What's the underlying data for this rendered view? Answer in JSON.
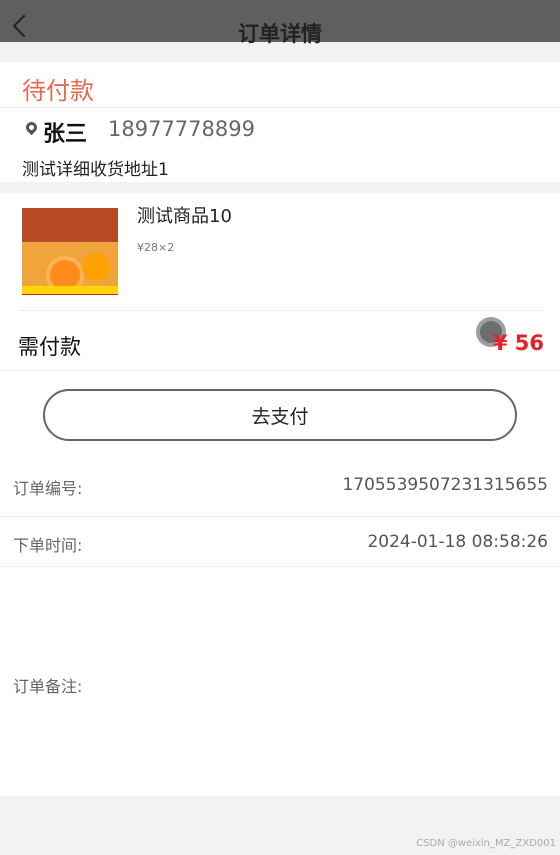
{
  "header": {
    "title": "订单详情",
    "back_icon": "chevron-left-icon"
  },
  "status": {
    "text": "待付款",
    "color": "#e46b4f"
  },
  "address": {
    "name": "张三",
    "phone": "18977778899",
    "detail": "测试详细收货地址1",
    "icon": "location-pin-icon"
  },
  "goods": {
    "name": "测试商品10",
    "spec": "¥28×2"
  },
  "payment": {
    "need_label": "需付款",
    "amount": "¥ 56",
    "pay_button": "去支付",
    "accent": "#e8202a"
  },
  "order_info": {
    "number_label": "订单编号:",
    "number_value": "1705539507231315655",
    "time_label": "下单时间:",
    "time_value": "2024-01-18 08:58:26",
    "remark_label": "订单备注:"
  },
  "watermark": "CSDN @weixin_MZ_ZXD001"
}
